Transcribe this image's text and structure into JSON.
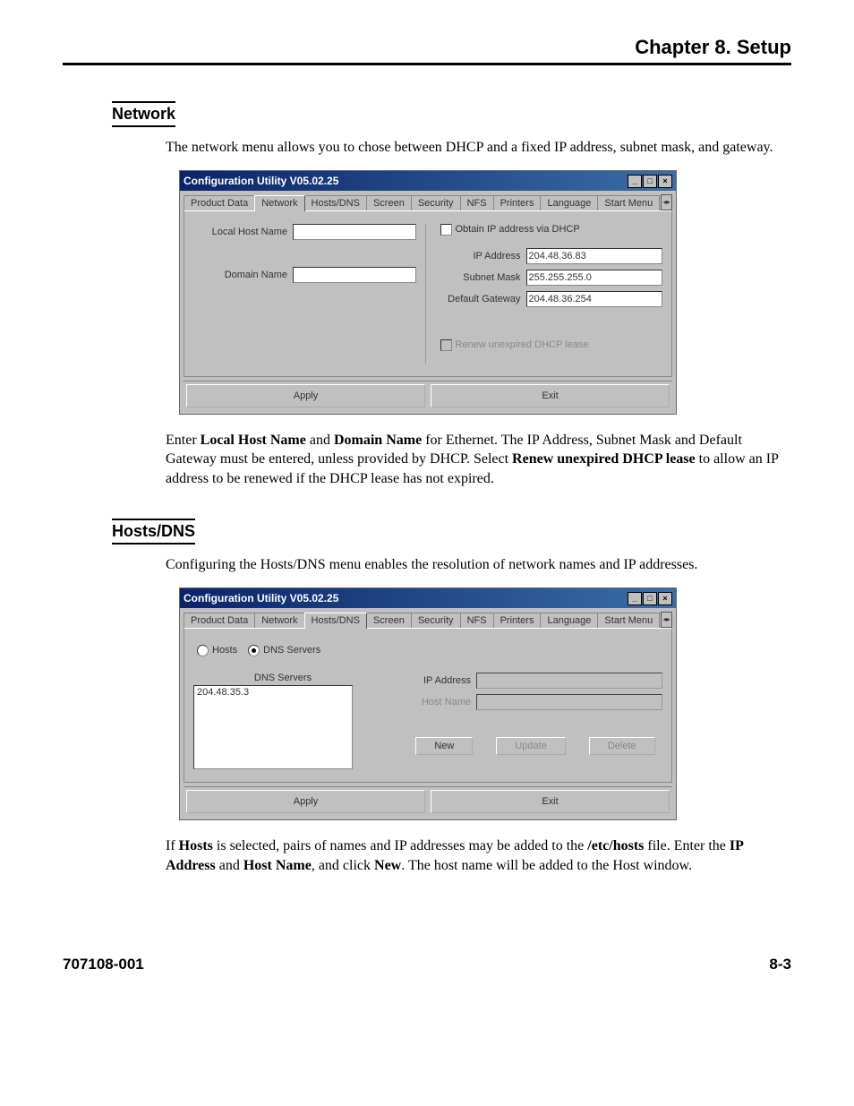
{
  "header": {
    "chapter": "Chapter 8.  Setup"
  },
  "section_network": {
    "title": "Network",
    "intro": "The network menu allows you to chose between DHCP and a fixed IP address, subnet mask, and gateway.",
    "after_text": {
      "t1": "Enter ",
      "b1": "Local Host Name",
      "t2": " and ",
      "b2": "Domain Name",
      "t3": " for Ethernet.  The IP Address, Subnet Mask and Default Gateway must be entered, unless provided by DHCP. Select ",
      "b3": "Renew unexpired DHCP lease",
      "t4": " to allow an IP address to be renewed if the DHCP lease has not expired."
    }
  },
  "section_hosts": {
    "title": "Hosts/DNS",
    "intro": "Configuring the Hosts/DNS menu enables the resolution of network names and IP addresses.",
    "after_text": {
      "t1": "If ",
      "b1": "Hosts",
      "t2": " is selected, pairs of names and IP addresses may be added to the ",
      "b2": "/etc/hosts",
      "t3": " file. Enter the ",
      "b3": "IP Address",
      "t4": " and ",
      "b4": "Host Name",
      "t5": ", and click ",
      "b5": "New",
      "t6": ". The host name will be added to the Host window."
    }
  },
  "window": {
    "title": "Configuration Utility V05.02.25",
    "tabs": [
      "Product Data",
      "Network",
      "Hosts/DNS",
      "Screen",
      "Security",
      "NFS",
      "Printers",
      "Language",
      "Start Menu"
    ],
    "network": {
      "local_host_label": "Local Host Name",
      "domain_label": "Domain Name",
      "dhcp_checkbox": "Obtain IP address via DHCP",
      "ip_label": "IP Address",
      "ip_value": "204.48.36.83",
      "subnet_label": "Subnet Mask",
      "subnet_value": "255.255.255.0",
      "gateway_label": "Default Gateway",
      "gateway_value": "204.48.36.254",
      "renew_checkbox": "Renew unexpired DHCP lease",
      "apply": "Apply",
      "exit": "Exit"
    },
    "hosts": {
      "radio_hosts": "Hosts",
      "radio_dns": "DNS Servers",
      "listbox_label": "DNS Servers",
      "listbox_item": "204.48.35.3",
      "ip_label": "IP Address",
      "hostname_label": "Host Name",
      "new": "New",
      "update": "Update",
      "delete": "Delete",
      "apply": "Apply",
      "exit": "Exit"
    }
  },
  "footer": {
    "docnum": "707108-001",
    "pagenum": "8-3"
  }
}
